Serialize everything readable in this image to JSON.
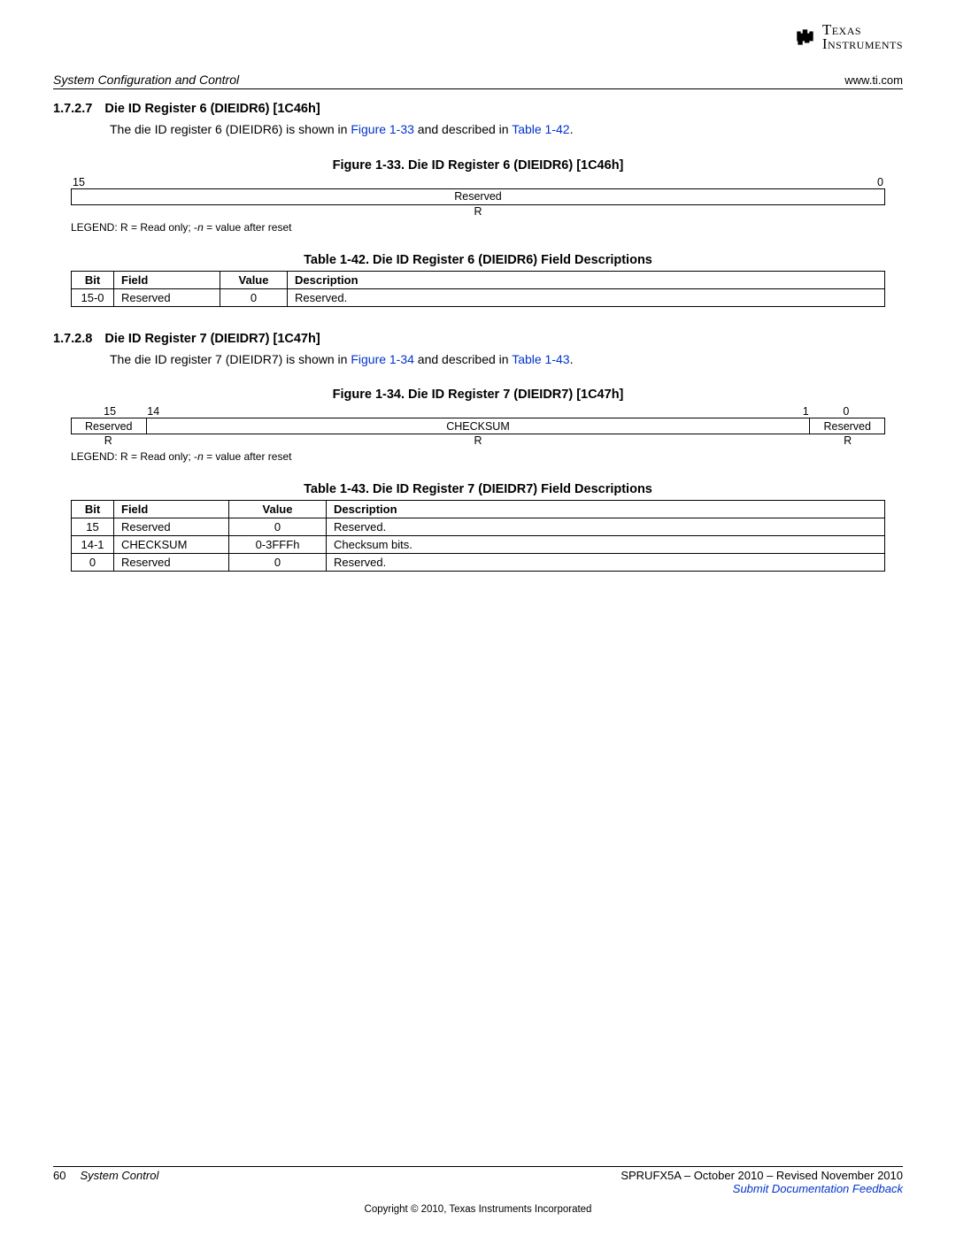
{
  "header": {
    "section_path": "System Configuration and Control",
    "site": "www.ti.com"
  },
  "logo": {
    "line1": "Texas",
    "line2": "Instruments"
  },
  "sec1": {
    "num": "1.7.2.7",
    "title": "Die ID Register 6 (DIEIDR6) [1C46h]",
    "body_pre": "The die ID register 6 (DIEIDR6) is shown in ",
    "link_fig": "Figure 1-33",
    "body_mid": " and described in ",
    "link_tbl": "Table 1-42",
    "body_post": "."
  },
  "fig33": {
    "title": "Figure 1-33. Die ID Register 6 (DIEIDR6) [1C46h]",
    "bit_hi": "15",
    "bit_lo": "0",
    "field": "Reserved",
    "access": "R",
    "legend_pre": "LEGEND: R = Read only; -",
    "legend_n": "n",
    "legend_post": " = value after reset"
  },
  "tbl42": {
    "title": "Table 1-42. Die ID Register 6 (DIEIDR6) Field Descriptions",
    "h_bit": "Bit",
    "h_field": "Field",
    "h_value": "Value",
    "h_desc": "Description",
    "r0": {
      "bit": "15-0",
      "field": "Reserved",
      "value": "0",
      "desc": "Reserved."
    }
  },
  "sec2": {
    "num": "1.7.2.8",
    "title": "Die ID Register 7 (DIEIDR7) [1C47h]",
    "body_pre": "The die ID register 7 (DIEIDR7) is shown in ",
    "link_fig": "Figure 1-34",
    "body_mid": " and described in ",
    "link_tbl": "Table 1-43",
    "body_post": "."
  },
  "fig34": {
    "title": "Figure 1-34. Die ID Register 7 (DIEIDR7) [1C47h]",
    "bit_15": "15",
    "bit_14": "14",
    "bit_1": "1",
    "bit_0": "0",
    "f1": "Reserved",
    "f2": "CHECKSUM",
    "f3": "Reserved",
    "a1": "R",
    "a2": "R",
    "a3": "R",
    "legend_pre": "LEGEND: R = Read only; -",
    "legend_n": "n",
    "legend_post": " = value after reset"
  },
  "tbl43": {
    "title": "Table 1-43. Die ID Register 7 (DIEIDR7) Field Descriptions",
    "h_bit": "Bit",
    "h_field": "Field",
    "h_value": "Value",
    "h_desc": "Description",
    "r0": {
      "bit": "15",
      "field": "Reserved",
      "value": "0",
      "desc": "Reserved."
    },
    "r1": {
      "bit": "14-1",
      "field": "CHECKSUM",
      "value": "0-3FFFh",
      "desc": "Checksum bits."
    },
    "r2": {
      "bit": "0",
      "field": "Reserved",
      "value": "0",
      "desc": "Reserved."
    }
  },
  "footer": {
    "page": "60",
    "section": "System Control",
    "docrev": "SPRUFX5A – October 2010 – Revised November 2010",
    "feedback": "Submit Documentation Feedback",
    "copyright": "Copyright © 2010, Texas Instruments Incorporated"
  }
}
